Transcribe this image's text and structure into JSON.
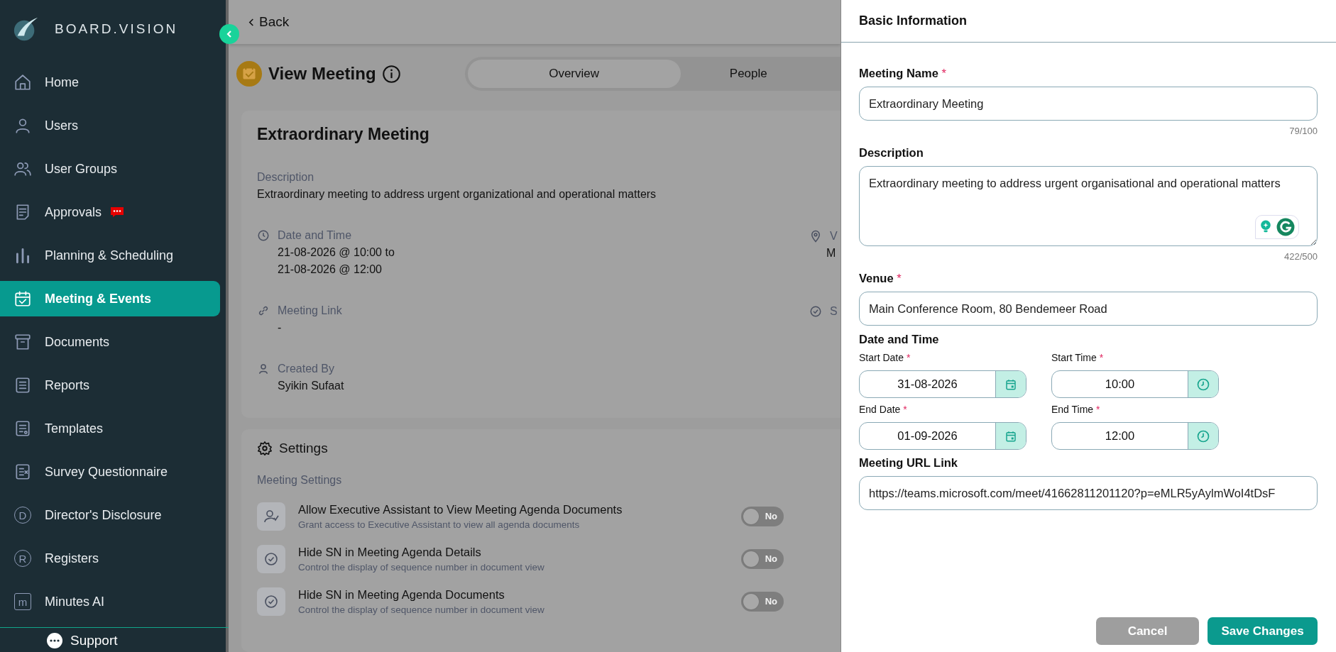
{
  "sidebar": {
    "brand": "BOARD.VISION",
    "items": [
      {
        "label": "Home",
        "selected": false,
        "badge": false
      },
      {
        "label": "Users",
        "selected": false,
        "badge": false
      },
      {
        "label": "User Groups",
        "selected": false,
        "badge": false
      },
      {
        "label": "Approvals",
        "selected": false,
        "badge": true
      },
      {
        "label": "Planning & Scheduling",
        "selected": false,
        "badge": false
      },
      {
        "label": "Meeting & Events",
        "selected": true,
        "badge": false
      },
      {
        "label": "Documents",
        "selected": false,
        "badge": false
      },
      {
        "label": "Reports",
        "selected": false,
        "badge": false
      },
      {
        "label": "Templates",
        "selected": false,
        "badge": false
      },
      {
        "label": "Survey Questionnaire",
        "selected": false,
        "badge": false
      },
      {
        "label": "Director's Disclosure",
        "selected": false,
        "badge": false,
        "glyph": "D"
      },
      {
        "label": "Registers",
        "selected": false,
        "badge": false,
        "glyph": "R"
      },
      {
        "label": "Minutes AI",
        "selected": false,
        "badge": false,
        "glyph": "m"
      }
    ],
    "support": "Support"
  },
  "back": "Back",
  "page": {
    "title": "View Meeting",
    "tabs": [
      {
        "label": "Overview",
        "selected": true
      },
      {
        "label": "People",
        "selected": false
      }
    ]
  },
  "details": {
    "title": "Extraordinary Meeting",
    "description_label": "Description",
    "description": "Extraordinary meeting to address urgent organizational and operational matters",
    "date_label": "Date and Time",
    "date_lines": [
      "21-08-2026 @ 10:00 to",
      "21-08-2026 @ 12:00"
    ],
    "link_label": "Meeting Link",
    "link": "-",
    "created_label": "Created By",
    "created_by": "Syikin Sufaat",
    "venue_label": "V",
    "venue": "M",
    "status_label": "S"
  },
  "settings": {
    "title": "Settings",
    "section": "Meeting Settings",
    "items": [
      {
        "title": "Allow Executive Assistant to View Meeting Agenda Documents",
        "subtitle": "Grant access to Executive Assistant to view all agenda documents",
        "on": false,
        "toggle_label": "No"
      },
      {
        "title": "Hide SN in Meeting Agenda Details",
        "subtitle": "Control the display of sequence number in document view",
        "on": false,
        "toggle_label": "No"
      },
      {
        "title": "Hide SN in Meeting Agenda Documents",
        "subtitle": "Control the display of sequence number in document view",
        "on": false,
        "toggle_label": "No"
      }
    ]
  },
  "panel": {
    "title": "Basic Information",
    "meeting_name": {
      "label": "Meeting Name",
      "mark": "*",
      "value": "Extraordinary Meeting",
      "counter": "79/100"
    },
    "description": {
      "label": "Description",
      "value": "Extraordinary meeting to address urgent organisational and operational matters",
      "counter": "422/500"
    },
    "venue": {
      "label": "Venue",
      "mark": "*",
      "value": "Main Conference Room, 80 Bendemeer Road"
    },
    "date_time_label": "Date and Time",
    "pickers": [
      {
        "kind": "date",
        "label": "Start Date",
        "mark": "*",
        "value": "31-08-2026"
      },
      {
        "kind": "time",
        "label": "Start Time",
        "mark": "*",
        "value": "10:00"
      },
      {
        "kind": "date",
        "label": "End Date",
        "mark": "*",
        "value": "01-09-2026"
      },
      {
        "kind": "time",
        "label": "End Time",
        "mark": "*",
        "value": "12:00"
      }
    ],
    "url": {
      "label": "Meeting URL Link",
      "value": "https://teams.microsoft.com/meet/41662811201120?p=eMLR5yAylmWoI4tDsF"
    },
    "buttons": {
      "cancel": "Cancel",
      "save": "Save Changes"
    }
  }
}
